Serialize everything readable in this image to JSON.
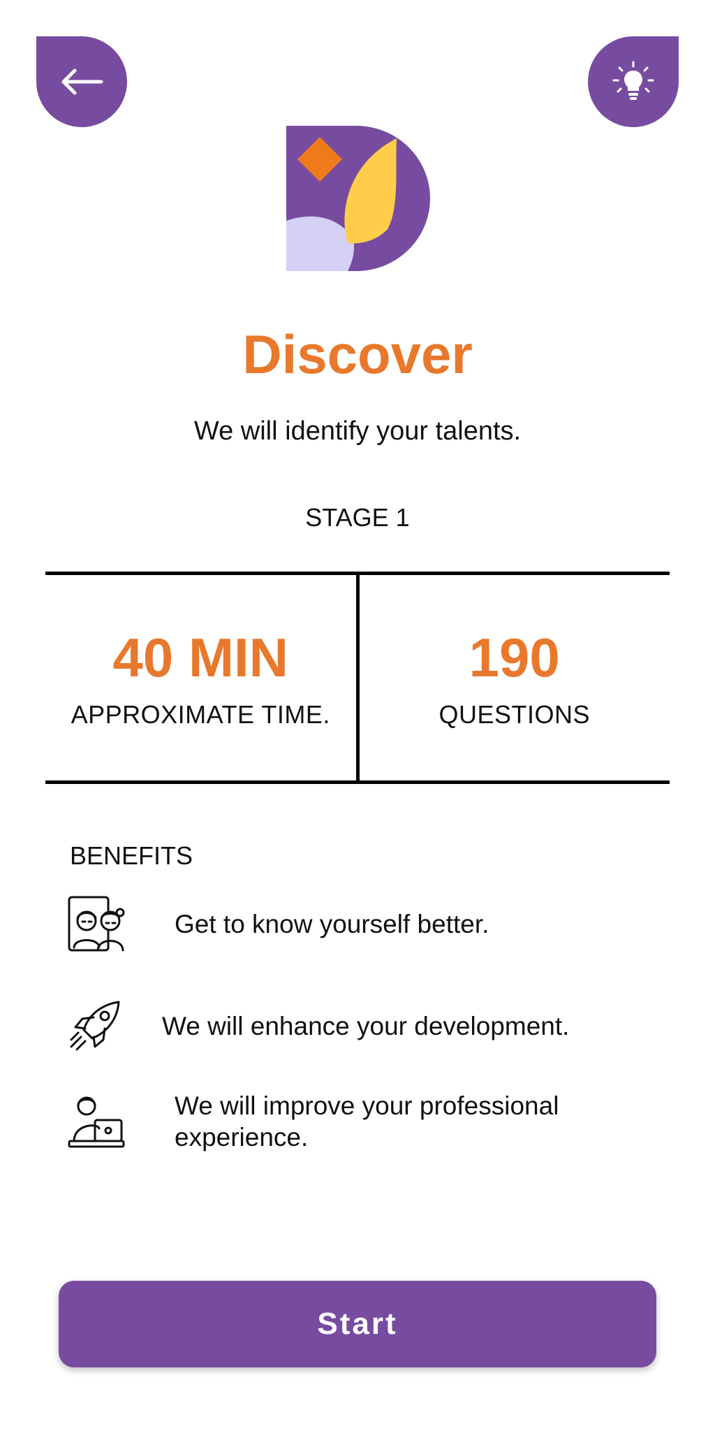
{
  "header": {
    "back_icon": "arrow-left-icon",
    "hint_icon": "lightbulb-icon"
  },
  "logo": {
    "icon": "discover-logo",
    "colors": {
      "purple": "#774ca0",
      "orange": "#ef7a19",
      "yellow": "#ffcd4a",
      "lavender": "#d5d0f5"
    }
  },
  "main": {
    "title": "Discover",
    "subtitle": "We will identify your talents.",
    "stage": "STAGE 1"
  },
  "stats": [
    {
      "value": "40 MIN",
      "label": "APPROXIMATE TIME."
    },
    {
      "value": "190",
      "label": "QUESTIONS"
    }
  ],
  "benefits": {
    "heading": "BENEFITS",
    "items": [
      {
        "icon": "friends-icon",
        "text": "Get to know yourself better."
      },
      {
        "icon": "rocket-icon",
        "text": "We will enhance your development."
      },
      {
        "icon": "professional-laptop-icon",
        "text": "We will improve your professional experience."
      }
    ]
  },
  "actions": {
    "start_label": "Start"
  },
  "colors": {
    "accent": "#774ca0",
    "highlight": "#e8792c"
  }
}
